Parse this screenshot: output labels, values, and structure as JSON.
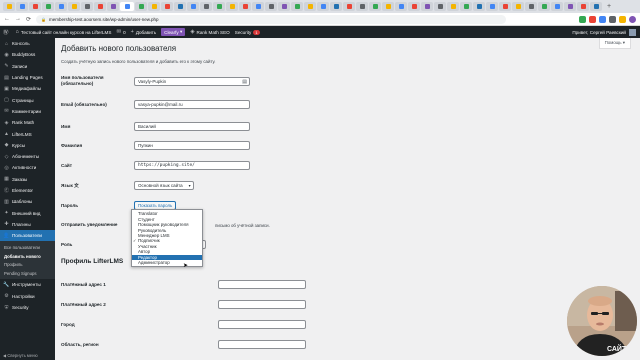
{
  "browser": {
    "tabs": [
      {
        "color": "#f4b400"
      },
      {
        "color": "#4285f4"
      },
      {
        "color": "#ea4335"
      },
      {
        "color": "#34a853"
      },
      {
        "color": "#4285f4"
      },
      {
        "color": "#f4b400"
      },
      {
        "color": "#5f6368"
      },
      {
        "color": "#ea4335"
      },
      {
        "color": "#7f54b3"
      },
      {
        "color": "#4285f4"
      },
      {
        "color": "#34a853"
      },
      {
        "color": "#f4b400"
      },
      {
        "color": "#ea4335"
      },
      {
        "color": "#2271b1"
      },
      {
        "color": "#4285f4"
      },
      {
        "color": "#5f6368"
      },
      {
        "color": "#34a853"
      },
      {
        "color": "#f4b400"
      },
      {
        "color": "#ea4335"
      },
      {
        "color": "#4285f4"
      },
      {
        "color": "#5f6368"
      },
      {
        "color": "#7f54b3"
      },
      {
        "color": "#34a853"
      },
      {
        "color": "#f4b400"
      },
      {
        "color": "#4285f4"
      },
      {
        "color": "#2271b1"
      },
      {
        "color": "#ea4335"
      },
      {
        "color": "#5f6368"
      },
      {
        "color": "#34a853"
      },
      {
        "color": "#f4b400"
      },
      {
        "color": "#4285f4"
      },
      {
        "color": "#ea4335"
      },
      {
        "color": "#7f54b3"
      },
      {
        "color": "#5f6368"
      },
      {
        "color": "#f4b400"
      },
      {
        "color": "#34a853"
      },
      {
        "color": "#2271b1"
      },
      {
        "color": "#4285f4"
      },
      {
        "color": "#ea4335"
      },
      {
        "color": "#f4b400"
      },
      {
        "color": "#5f6368"
      },
      {
        "color": "#34a853"
      },
      {
        "color": "#4285f4"
      },
      {
        "color": "#7f54b3"
      },
      {
        "color": "#ea4335"
      },
      {
        "color": "#2271b1"
      }
    ],
    "url": "membership-test.aoorsem.site/wp-admin/user-new.php",
    "back": "←",
    "forward": "→",
    "reload": "⟳",
    "lock": "🔒",
    "plus": "+"
  },
  "adminbar": {
    "site_name": "Тестовый сайт онлайн курсов на LifterLMS",
    "comments_count": "0",
    "new_label": "Добавить",
    "clearfy": "Clearfy",
    "rankmath": "Rank Math SEO",
    "security": "Security",
    "security_badge": "1",
    "howdy": "Привет,",
    "user_name": "Сергей Раевский"
  },
  "sidebar": {
    "items": [
      {
        "icon": "⌂",
        "label": "Консоль"
      },
      {
        "icon": "◉",
        "label": "BuddyBoss"
      },
      {
        "icon": "✎",
        "label": "Записи"
      },
      {
        "icon": "▤",
        "label": "Landing Pages"
      },
      {
        "icon": "▣",
        "label": "Медиафайлы"
      },
      {
        "icon": "▢",
        "label": "Страницы"
      },
      {
        "icon": "✉",
        "label": "Комментарии"
      },
      {
        "icon": "◈",
        "label": "Rank Math"
      },
      {
        "icon": "▲",
        "label": "LifterLMS"
      },
      {
        "icon": "◆",
        "label": "Курсы"
      },
      {
        "icon": "◇",
        "label": "Абонементы"
      },
      {
        "icon": "◎",
        "label": "Активности"
      },
      {
        "icon": "▦",
        "label": "Заказы"
      },
      {
        "icon": "Ⓔ",
        "label": "Elementor"
      },
      {
        "icon": "▥",
        "label": "Шаблоны"
      },
      {
        "icon": "✦",
        "label": "Внешний вид"
      },
      {
        "icon": "✚",
        "label": "Плагины"
      },
      {
        "icon": "👤",
        "label": "Пользователи"
      }
    ],
    "submenu": [
      "Все пользователи",
      "Добавить нового",
      "Профиль",
      "Pending Signups"
    ],
    "items_after": [
      {
        "icon": "🔧",
        "label": "Инструменты"
      },
      {
        "icon": "⚙",
        "label": "Настройки"
      },
      {
        "icon": "⛨",
        "label": "Security"
      }
    ],
    "collapse": "Свернуть меню"
  },
  "main": {
    "help": "Помощь ▾",
    "title": "Добавить нового пользователя",
    "intro": "Создать учётную запись нового пользователя и добавить его к этому сайту.",
    "fields": {
      "username_label": "Имя пользователя",
      "username_req": "(обязательно)",
      "username_value": "Vasyly-Pupkin",
      "email_label": "Email",
      "email_req": "(обязательно)",
      "email_value": "vasya-pupkin@mail.ru",
      "firstname_label": "Имя",
      "firstname_value": "Василий",
      "lastname_label": "Фамилия",
      "lastname_value": "Пупкин",
      "site_label": "Сайт",
      "site_value": "https://pupking.site/",
      "lang_label": "Язык",
      "lang_value": "Основной язык сайта",
      "password_label": "Пароль",
      "password_button": "Показать пароль",
      "notify_label": "Отправить уведомление",
      "notify_text": "письмо об учётной записи.",
      "role_label": "Роль"
    },
    "role_options": [
      "Translator",
      "Студент",
      "Помощник руководителя",
      "Руководитель",
      "Менеджер LMS",
      "Подписчик",
      "Участник",
      "Автор",
      "Редактор",
      "Администратор"
    ],
    "role_checked_index": 5,
    "role_highlight_index": 8,
    "lifter_heading": "Профиль LifterLMS",
    "lifter_fields": [
      "Платёжный адрес 1",
      "Платёжный адрес 2",
      "Город",
      "Область, регион"
    ]
  },
  "webcam": {
    "shirt_text": "САЙТ"
  }
}
